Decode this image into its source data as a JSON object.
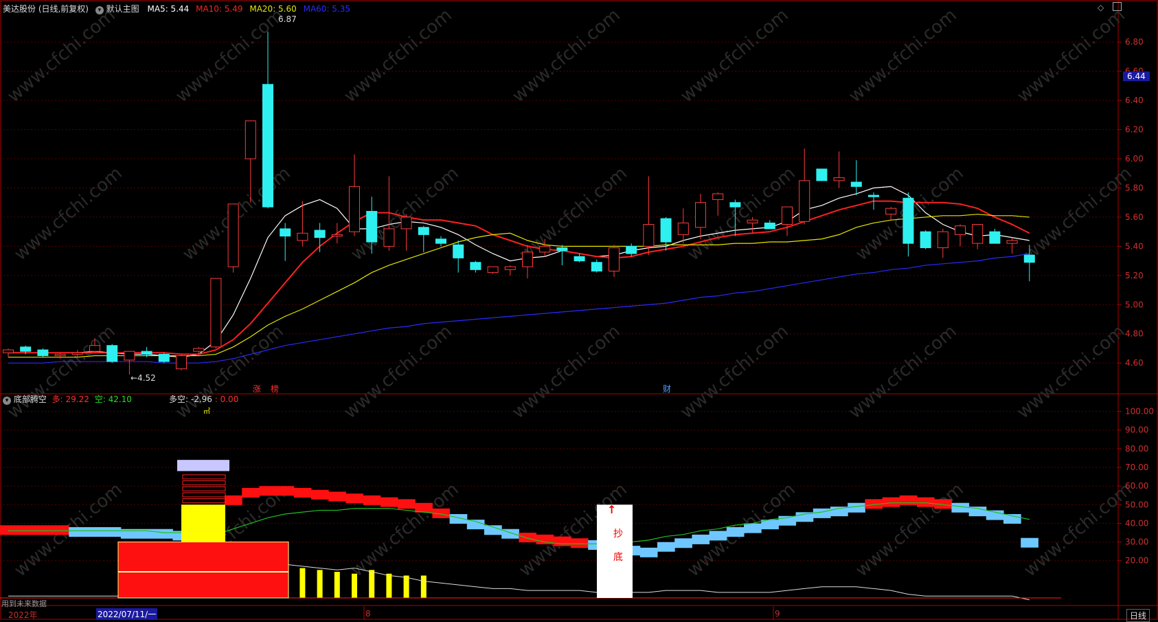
{
  "top_header": {
    "stock_title": "美达股份 (日线,前复权)",
    "main_chart_label": "默认主图",
    "ma5": "MA5: 5.44",
    "ma10": "MA10: 5.49",
    "ma20": "MA20: 5.60",
    "ma60": "MA60: 5.35",
    "colors": {
      "ma5": "#ffffff",
      "ma10": "#ff2020",
      "ma20": "#e6e600",
      "ma60": "#2a2aff"
    },
    "icons": [
      "chevron-down-icon",
      "diamond-icon",
      "restore-icon"
    ]
  },
  "indicator_header": {
    "name": "底部腾空",
    "duo": "多: 29.22",
    "kong": "空: 42.10",
    "duokong": "多空: -2.96",
    "duokong_value2": ": 0.00"
  },
  "price_axis": [
    "6.80",
    "6.60",
    "6.40",
    "6.20",
    "6.00",
    "5.80",
    "5.60",
    "5.40",
    "5.20",
    "5.00",
    "4.80",
    "4.60"
  ],
  "current_price": "6.44",
  "indicator_axis": [
    "100.00",
    "90.00",
    "80.00",
    "70.00",
    "60.00",
    "50.00",
    "40.00",
    "30.00",
    "20.00"
  ],
  "annotations": {
    "high": "6.87",
    "low": "←4.52",
    "tag_zhang": "涨",
    "tag_bang": "榜",
    "tag_cai": "财",
    "small_mark": "㎡",
    "chaodi_line1": "抄",
    "chaodi_line2": "底"
  },
  "bottom_bar": {
    "future_data": "用到未来数据",
    "year": "2022年",
    "cursor_date": "2022/07/11/一",
    "month_8": "8",
    "month_9": "9",
    "period": "日线"
  },
  "watermark": "www.cfchi.com",
  "chart_data": [
    {
      "type": "candlestick",
      "title": "美达股份 (日线,前复权)",
      "ylim": [
        4.45,
        6.9
      ],
      "x_labels": [
        "2022年",
        "8",
        "9"
      ],
      "candles": [
        {
          "o": 4.67,
          "h": 4.7,
          "l": 4.64,
          "c": 4.69
        },
        {
          "o": 4.71,
          "h": 4.72,
          "l": 4.66,
          "c": 4.68
        },
        {
          "o": 4.69,
          "h": 4.7,
          "l": 4.64,
          "c": 4.65
        },
        {
          "o": 4.65,
          "h": 4.67,
          "l": 4.63,
          "c": 4.66
        },
        {
          "o": 4.66,
          "h": 4.69,
          "l": 4.64,
          "c": 4.67
        },
        {
          "o": 4.68,
          "h": 4.77,
          "l": 4.67,
          "c": 4.72
        },
        {
          "o": 4.72,
          "h": 4.73,
          "l": 4.6,
          "c": 4.61
        },
        {
          "o": 4.62,
          "h": 4.68,
          "l": 4.52,
          "c": 4.68
        },
        {
          "o": 4.68,
          "h": 4.71,
          "l": 4.64,
          "c": 4.66
        },
        {
          "o": 4.66,
          "h": 4.67,
          "l": 4.6,
          "c": 4.61
        },
        {
          "o": 4.56,
          "h": 4.66,
          "l": 4.55,
          "c": 4.65
        },
        {
          "o": 4.68,
          "h": 4.71,
          "l": 4.66,
          "c": 4.7
        },
        {
          "o": 4.71,
          "h": 5.18,
          "l": 4.7,
          "c": 5.18
        },
        {
          "o": 5.26,
          "h": 5.69,
          "l": 5.22,
          "c": 5.69
        },
        {
          "o": 6.0,
          "h": 6.26,
          "l": 5.7,
          "c": 6.26
        },
        {
          "o": 6.51,
          "h": 6.87,
          "l": 5.66,
          "c": 5.67
        },
        {
          "o": 5.52,
          "h": 5.56,
          "l": 5.3,
          "c": 5.47
        },
        {
          "o": 5.44,
          "h": 5.71,
          "l": 5.4,
          "c": 5.49
        },
        {
          "o": 5.51,
          "h": 5.56,
          "l": 5.36,
          "c": 5.46
        },
        {
          "o": 5.47,
          "h": 5.56,
          "l": 5.42,
          "c": 5.48
        },
        {
          "o": 5.5,
          "h": 6.03,
          "l": 5.47,
          "c": 5.81
        },
        {
          "o": 5.64,
          "h": 5.74,
          "l": 5.35,
          "c": 5.43
        },
        {
          "o": 5.4,
          "h": 5.88,
          "l": 5.37,
          "c": 5.52
        },
        {
          "o": 5.52,
          "h": 5.62,
          "l": 5.37,
          "c": 5.6
        },
        {
          "o": 5.53,
          "h": 5.54,
          "l": 5.36,
          "c": 5.48
        },
        {
          "o": 5.45,
          "h": 5.47,
          "l": 5.4,
          "c": 5.42
        },
        {
          "o": 5.41,
          "h": 5.44,
          "l": 5.22,
          "c": 5.32
        },
        {
          "o": 5.29,
          "h": 5.3,
          "l": 5.22,
          "c": 5.24
        },
        {
          "o": 5.22,
          "h": 5.26,
          "l": 5.21,
          "c": 5.26
        },
        {
          "o": 5.24,
          "h": 5.27,
          "l": 5.2,
          "c": 5.26
        },
        {
          "o": 5.26,
          "h": 5.41,
          "l": 5.18,
          "c": 5.36
        },
        {
          "o": 5.36,
          "h": 5.45,
          "l": 5.33,
          "c": 5.4
        },
        {
          "o": 5.39,
          "h": 5.41,
          "l": 5.27,
          "c": 5.37
        },
        {
          "o": 5.33,
          "h": 5.35,
          "l": 5.29,
          "c": 5.3
        },
        {
          "o": 5.29,
          "h": 5.31,
          "l": 5.22,
          "c": 5.23
        },
        {
          "o": 5.23,
          "h": 5.41,
          "l": 5.19,
          "c": 5.39
        },
        {
          "o": 5.4,
          "h": 5.42,
          "l": 5.33,
          "c": 5.35
        },
        {
          "o": 5.4,
          "h": 5.88,
          "l": 5.34,
          "c": 5.55
        },
        {
          "o": 5.59,
          "h": 5.6,
          "l": 5.37,
          "c": 5.43
        },
        {
          "o": 5.48,
          "h": 5.66,
          "l": 5.42,
          "c": 5.56
        },
        {
          "o": 5.53,
          "h": 5.76,
          "l": 5.45,
          "c": 5.7
        },
        {
          "o": 5.72,
          "h": 5.77,
          "l": 5.61,
          "c": 5.76
        },
        {
          "o": 5.7,
          "h": 5.72,
          "l": 5.47,
          "c": 5.67
        },
        {
          "o": 5.56,
          "h": 5.6,
          "l": 5.49,
          "c": 5.58
        },
        {
          "o": 5.56,
          "h": 5.58,
          "l": 5.52,
          "c": 5.52
        },
        {
          "o": 5.55,
          "h": 5.61,
          "l": 5.47,
          "c": 5.67
        },
        {
          "o": 5.57,
          "h": 6.07,
          "l": 5.55,
          "c": 5.85
        },
        {
          "o": 5.93,
          "h": 5.93,
          "l": 5.85,
          "c": 5.85
        },
        {
          "o": 5.85,
          "h": 6.05,
          "l": 5.8,
          "c": 5.87
        },
        {
          "o": 5.84,
          "h": 5.99,
          "l": 5.75,
          "c": 5.81
        },
        {
          "o": 5.75,
          "h": 5.77,
          "l": 5.65,
          "c": 5.74
        },
        {
          "o": 5.62,
          "h": 5.67,
          "l": 5.58,
          "c": 5.66
        },
        {
          "o": 5.73,
          "h": 5.77,
          "l": 5.33,
          "c": 5.42
        },
        {
          "o": 5.5,
          "h": 5.51,
          "l": 5.38,
          "c": 5.39
        },
        {
          "o": 5.39,
          "h": 5.52,
          "l": 5.32,
          "c": 5.5
        },
        {
          "o": 5.48,
          "h": 5.55,
          "l": 5.4,
          "c": 5.54
        },
        {
          "o": 5.42,
          "h": 5.55,
          "l": 5.38,
          "c": 5.55
        },
        {
          "o": 5.5,
          "h": 5.52,
          "l": 5.42,
          "c": 5.42
        },
        {
          "o": 5.42,
          "h": 5.46,
          "l": 5.35,
          "c": 5.44
        },
        {
          "o": 5.34,
          "h": 5.41,
          "l": 5.16,
          "c": 5.29
        }
      ],
      "series": [
        {
          "name": "MA5",
          "values": [
            4.67,
            4.67,
            4.67,
            4.67,
            4.67,
            4.68,
            4.67,
            4.66,
            4.66,
            4.65,
            4.64,
            4.66,
            4.75,
            4.93,
            5.18,
            5.46,
            5.61,
            5.68,
            5.72,
            5.66,
            5.52,
            5.52,
            5.55,
            5.57,
            5.56,
            5.53,
            5.48,
            5.41,
            5.35,
            5.3,
            5.32,
            5.33,
            5.37,
            5.35,
            5.33,
            5.34,
            5.37,
            5.39,
            5.4,
            5.44,
            5.47,
            5.49,
            5.51,
            5.52,
            5.53,
            5.57,
            5.65,
            5.68,
            5.73,
            5.76,
            5.8,
            5.81,
            5.75,
            5.63,
            5.55,
            5.5,
            5.47,
            5.48,
            5.46,
            5.44
          ]
        },
        {
          "name": "MA10",
          "values": [
            4.67,
            4.67,
            4.67,
            4.67,
            4.67,
            4.67,
            4.67,
            4.67,
            4.67,
            4.67,
            4.66,
            4.66,
            4.69,
            4.76,
            4.87,
            5.01,
            5.15,
            5.29,
            5.4,
            5.49,
            5.57,
            5.63,
            5.63,
            5.6,
            5.58,
            5.58,
            5.56,
            5.54,
            5.48,
            5.44,
            5.4,
            5.38,
            5.37,
            5.35,
            5.33,
            5.32,
            5.33,
            5.36,
            5.38,
            5.4,
            5.43,
            5.46,
            5.48,
            5.49,
            5.5,
            5.53,
            5.57,
            5.61,
            5.65,
            5.68,
            5.71,
            5.71,
            5.7,
            5.7,
            5.7,
            5.69,
            5.66,
            5.6,
            5.55,
            5.49
          ]
        },
        {
          "name": "MA20",
          "values": [
            4.64,
            4.64,
            4.64,
            4.64,
            4.64,
            4.65,
            4.65,
            4.65,
            4.65,
            4.65,
            4.65,
            4.65,
            4.66,
            4.71,
            4.78,
            4.86,
            4.92,
            4.97,
            5.03,
            5.09,
            5.15,
            5.22,
            5.27,
            5.31,
            5.35,
            5.39,
            5.43,
            5.46,
            5.48,
            5.49,
            5.44,
            5.41,
            5.4,
            5.4,
            5.4,
            5.4,
            5.4,
            5.4,
            5.41,
            5.41,
            5.41,
            5.41,
            5.42,
            5.42,
            5.43,
            5.43,
            5.44,
            5.45,
            5.48,
            5.53,
            5.56,
            5.58,
            5.59,
            5.6,
            5.61,
            5.61,
            5.62,
            5.61,
            5.61,
            5.6
          ]
        },
        {
          "name": "MA60",
          "values": [
            4.6,
            4.6,
            4.6,
            4.61,
            4.61,
            4.61,
            4.61,
            4.61,
            4.61,
            4.6,
            4.6,
            4.6,
            4.61,
            4.63,
            4.66,
            4.69,
            4.72,
            4.74,
            4.76,
            4.78,
            4.8,
            4.82,
            4.84,
            4.85,
            4.87,
            4.88,
            4.89,
            4.9,
            4.91,
            4.92,
            4.93,
            4.94,
            4.95,
            4.96,
            4.97,
            4.98,
            4.99,
            5.0,
            5.01,
            5.03,
            5.05,
            5.06,
            5.08,
            5.09,
            5.11,
            5.13,
            5.15,
            5.17,
            5.19,
            5.21,
            5.22,
            5.24,
            5.25,
            5.27,
            5.28,
            5.29,
            5.3,
            5.32,
            5.33,
            5.35
          ]
        }
      ]
    },
    {
      "type": "indicator",
      "title": "底部腾空",
      "ylim": [
        0,
        105
      ],
      "series": [
        {
          "name": "多",
          "values": [
            36,
            36,
            36,
            36,
            35,
            35,
            35,
            34,
            34,
            34,
            33,
            34,
            42,
            52,
            56,
            57,
            57,
            56,
            55,
            54,
            53,
            52,
            51,
            50,
            48,
            45,
            42,
            39,
            36,
            34,
            32,
            31,
            30,
            29,
            28,
            27,
            25,
            24,
            27,
            29,
            31,
            33,
            35,
            37,
            39,
            41,
            43,
            45,
            46,
            48,
            50,
            51,
            52,
            51,
            50,
            48,
            46,
            44,
            42,
            29.22
          ]
        },
        {
          "name": "空",
          "values": [
            36,
            36,
            36,
            36,
            36,
            36,
            36,
            36,
            36,
            35,
            35,
            35,
            34,
            37,
            40,
            43,
            45,
            46,
            47,
            47,
            48,
            48,
            48,
            47,
            46,
            45,
            43,
            41,
            38,
            35,
            32,
            30,
            29,
            29,
            29,
            29,
            30,
            31,
            33,
            34,
            36,
            37,
            39,
            40,
            42,
            43,
            45,
            46,
            48,
            49,
            50,
            51,
            51,
            51,
            50,
            49,
            48,
            46,
            44,
            42.1
          ]
        },
        {
          "name": "多空",
          "values": [
            1,
            1,
            1,
            1,
            1,
            1,
            1,
            1,
            1,
            1,
            1,
            1,
            10,
            20,
            25,
            23,
            18,
            17,
            16,
            15,
            16,
            14,
            12,
            11,
            9,
            8,
            7,
            6,
            5,
            5,
            4,
            4,
            4,
            4,
            3,
            4,
            3,
            3,
            4,
            4,
            4,
            3,
            3,
            3,
            3,
            4,
            5,
            6,
            6,
            6,
            5,
            4,
            2,
            1,
            1,
            1,
            1,
            1,
            1,
            -2.96
          ]
        }
      ],
      "bars_yellow": [
        0,
        0,
        0,
        0,
        0,
        0,
        0,
        0,
        0,
        0,
        0,
        0,
        0,
        15,
        23,
        22,
        18,
        16,
        15,
        14,
        13,
        15,
        13,
        12,
        12,
        0,
        0,
        0,
        0,
        0,
        0,
        0,
        0,
        0,
        0,
        0,
        0,
        0,
        0,
        0,
        0,
        0,
        0,
        0,
        0,
        0,
        0,
        0,
        0,
        0,
        0,
        0,
        0,
        0,
        0,
        0,
        0,
        0,
        0,
        0
      ]
    }
  ]
}
